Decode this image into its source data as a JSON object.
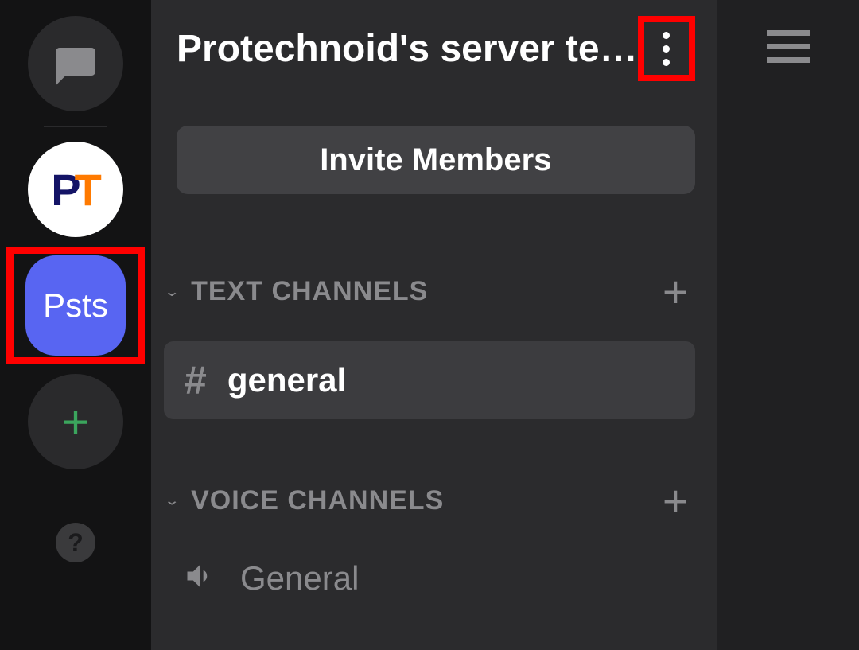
{
  "rail": {
    "server_pt": {
      "p": "P",
      "t": "T"
    },
    "server_psts_label": "Psts",
    "add_label": "+",
    "help_label": "?"
  },
  "header": {
    "title": "Protechnoid's server te…"
  },
  "invite": {
    "label": "Invite Members"
  },
  "sections": {
    "text": {
      "label": "TEXT CHANNELS",
      "channels": [
        {
          "name": "general"
        }
      ]
    },
    "voice": {
      "label": "VOICE CHANNELS",
      "channels": [
        {
          "name": "General"
        }
      ]
    }
  }
}
